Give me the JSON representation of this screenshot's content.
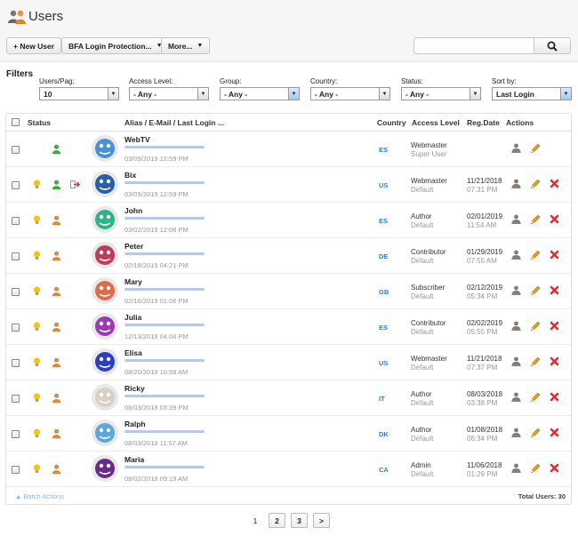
{
  "header": {
    "title": "Users",
    "new_user_label": "+ New User",
    "bfa_label": "BFA Login Protection...",
    "more_label": "More...",
    "search": {
      "value": "",
      "placeholder": ""
    }
  },
  "filters": {
    "title": "Filters",
    "users_per_page": {
      "label": "Users/Pag:",
      "value": "10"
    },
    "access_level": {
      "label": "Access Level:",
      "value": "- Any -"
    },
    "group": {
      "label": "Group:",
      "value": "- Any -"
    },
    "country": {
      "label": "Country:",
      "value": "- Any -"
    },
    "status": {
      "label": "Status:",
      "value": "- Any -"
    },
    "sort_by": {
      "label": "Sort by:",
      "value": "Last Login"
    }
  },
  "table": {
    "headers": {
      "status": "Status",
      "alias": "Alias / E-Mail / Last Login ...",
      "country": "Country",
      "access": "Access Level",
      "reg": "Reg.Date",
      "actions": "Actions"
    },
    "rows": [
      {
        "name": "WebTV",
        "last_login": "03/09/2019 12:59 PM",
        "country": "ES",
        "access": "Webmaster",
        "group": "Super User",
        "reg_date": "",
        "reg_time": "",
        "avatar_color": "#4a90d9",
        "show_bulb": false,
        "status_color": "#3fae3f",
        "logged_in": false,
        "can_delete": false
      },
      {
        "name": "Bix",
        "last_login": "03/09/2019 12:59 PM",
        "country": "US",
        "access": "Webmaster",
        "group": "Default",
        "reg_date": "11/21/2018",
        "reg_time": "07:31 PM",
        "avatar_color": "#2a5ea8",
        "show_bulb": true,
        "status_color": "#3fae3f",
        "logged_in": true,
        "can_delete": true
      },
      {
        "name": "John",
        "last_login": "03/02/2019 12:08 PM",
        "country": "ES",
        "access": "Author",
        "group": "Default",
        "reg_date": "02/01/2019",
        "reg_time": "11:54 AM",
        "avatar_color": "#2cb58a",
        "show_bulb": true,
        "status_color": "#e08a3a",
        "logged_in": false,
        "can_delete": true
      },
      {
        "name": "Peter",
        "last_login": "02/18/2019 04:21 PM",
        "country": "DE",
        "access": "Contributor",
        "group": "Default",
        "reg_date": "01/29/2019",
        "reg_time": "07:55 AM",
        "avatar_color": "#c23a5a",
        "show_bulb": true,
        "status_color": "#e08a3a",
        "logged_in": false,
        "can_delete": true
      },
      {
        "name": "Mary",
        "last_login": "02/16/2019 01:06 PM",
        "country": "GB",
        "access": "Subscriber",
        "group": "Default",
        "reg_date": "02/12/2019",
        "reg_time": "05:34 PM",
        "avatar_color": "#e06a4a",
        "show_bulb": true,
        "status_color": "#e08a3a",
        "logged_in": false,
        "can_delete": true
      },
      {
        "name": "Julia",
        "last_login": "12/13/2018 04:04 PM",
        "country": "ES",
        "access": "Contributor",
        "group": "Default",
        "reg_date": "02/02/2019",
        "reg_time": "05:55 PM",
        "avatar_color": "#9a3ab8",
        "show_bulb": true,
        "status_color": "#e08a3a",
        "logged_in": false,
        "can_delete": true
      },
      {
        "name": "Elisa",
        "last_login": "08/20/2018 10:58 AM",
        "country": "US",
        "access": "Webmaster",
        "group": "Default",
        "reg_date": "11/21/2018",
        "reg_time": "07:37 PM",
        "avatar_color": "#2a3ec8",
        "show_bulb": true,
        "status_color": "#e08a3a",
        "logged_in": false,
        "can_delete": true
      },
      {
        "name": "Ricky",
        "last_login": "08/03/2018 03:39 PM",
        "country": "IT",
        "access": "Author",
        "group": "Default",
        "reg_date": "08/03/2018",
        "reg_time": "03:38 PM",
        "avatar_color": "#d8d0c0",
        "show_bulb": true,
        "status_color": "#e08a3a",
        "logged_in": false,
        "can_delete": true
      },
      {
        "name": "Ralph",
        "last_login": "08/03/2018 11:57 AM",
        "country": "DK",
        "access": "Author",
        "group": "Default",
        "reg_date": "01/08/2018",
        "reg_time": "06:34 PM",
        "avatar_color": "#5aa8d8",
        "show_bulb": true,
        "status_color": "#e08a3a",
        "logged_in": false,
        "can_delete": true
      },
      {
        "name": "Maria",
        "last_login": "08/02/2018 09:19 AM",
        "country": "CA",
        "access": "Admin",
        "group": "Default",
        "reg_date": "11/06/2018",
        "reg_time": "01:29 PM",
        "avatar_color": "#6a2a8a",
        "show_bulb": true,
        "status_color": "#e08a3a",
        "logged_in": false,
        "can_delete": true
      }
    ],
    "batch_actions": "Batch Actions",
    "total_users": "Total Users: 30"
  },
  "pagination": {
    "current": "1",
    "pages": [
      "2",
      "3"
    ],
    "next": ">"
  }
}
